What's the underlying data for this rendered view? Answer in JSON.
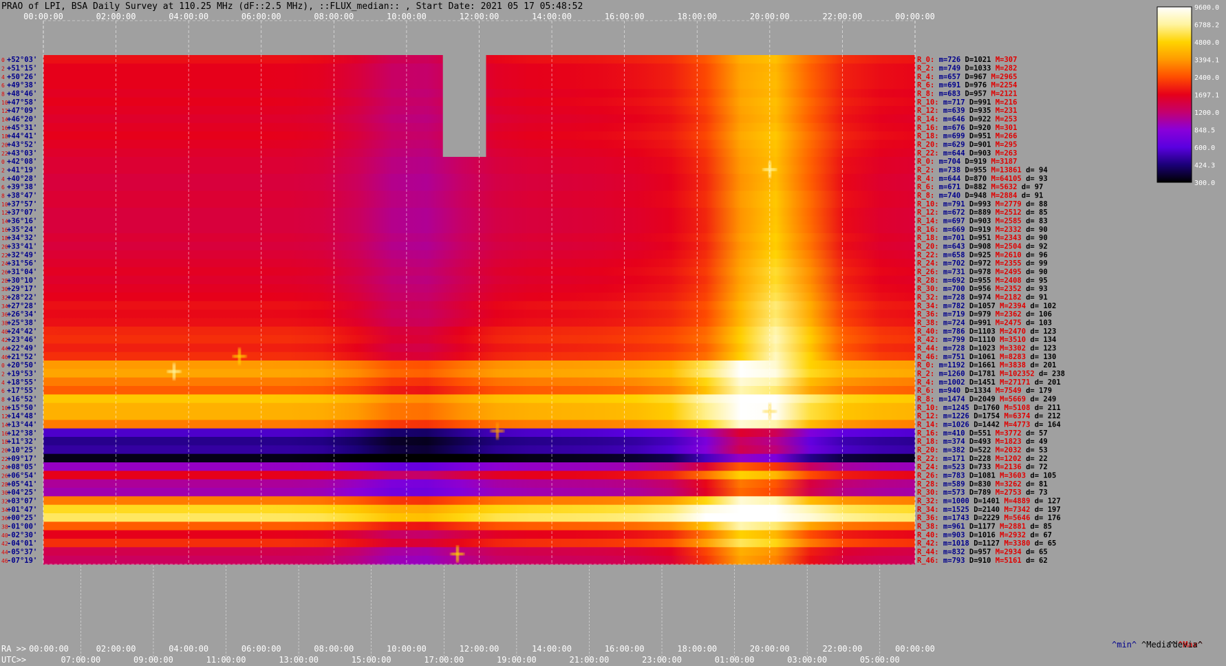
{
  "chart_data": {
    "type": "heatmap",
    "title": "PRAO of LPI, BSA Daily Survey at 110.25 MHz (dF::2.5 MHz), ::FLUX_median:: , Start Date: 2021 05 17 05:48:52",
    "ra_axis_label": "RA >>",
    "utc_axis_label": "UTC>>",
    "ra_ticks": [
      "00:00:00",
      "02:00:00",
      "04:00:00",
      "06:00:00",
      "08:00:00",
      "10:00:00",
      "12:00:00",
      "14:00:00",
      "16:00:00",
      "18:00:00",
      "20:00:00",
      "22:00:00",
      "00:00:00"
    ],
    "utc_ticks": [
      "07:00:00",
      "09:00:00",
      "11:00:00",
      "13:00:00",
      "15:00:00",
      "17:00:00",
      "19:00:00",
      "21:00:00",
      "23:00:00",
      "01:00:00",
      "03:00:00",
      "05:00:00"
    ],
    "color_scale_ticks": [
      "9600.0",
      "6788.2",
      "4800.0",
      "3394.1",
      "2400.0",
      "1697.1",
      "1200.0",
      "848.5",
      "600.0",
      "424.3",
      "300.0"
    ],
    "color_scale_colors": [
      "#ffffff",
      "#fff4a0",
      "#ffd300",
      "#ff9a00",
      "#ff4d00",
      "#e6001a",
      "#c4006e",
      "#8a00d9",
      "#5a00e0",
      "#1a0077",
      "#000000"
    ],
    "declinations": [
      "+52°03'",
      "+51°15'",
      "+50°26'",
      "+49°38'",
      "+48°46'",
      "+47°58'",
      "+47°09'",
      "+46°20'",
      "+45°31'",
      "+44°41'",
      "+43°52'",
      "+43°03'",
      "+42°08'",
      "+41°19'",
      "+40°28'",
      "+39°38'",
      "+38°47'",
      "+37°57'",
      "+37°07'",
      "+36°16'",
      "+35°24'",
      "+34°32'",
      "+33°41'",
      "+32°49'",
      "+31°56'",
      "+31°04'",
      "+30°10'",
      "+29°17'",
      "+28°22'",
      "+27°28'",
      "+26°34'",
      "+25°38'",
      "+24°42'",
      "+23°46'",
      "+22°49'",
      "+21°52'",
      "+20°50'",
      "+19°53'",
      "+18°55'",
      "+17°55'",
      "+16°52'",
      "+15°50'",
      "+14°48'",
      "+13°44'",
      "+12°38'",
      "+11°32'",
      "+10°25'",
      "+09°17'",
      "+08°05'",
      "+06°54'",
      "+05°41'",
      "+04°25'",
      "+03°07'",
      "+01°47'",
      "+00°25'",
      "-01°00'",
      "-02°30'",
      "-04°01'",
      "-05°37'",
      "-07°19'"
    ],
    "row_numbers": [
      "0",
      "2",
      "4",
      "6",
      "8",
      "10",
      "12",
      "14",
      "16",
      "18",
      "20",
      "22",
      "0",
      "2",
      "4",
      "6",
      "8",
      "10",
      "12",
      "14",
      "16",
      "18",
      "20",
      "22",
      "24",
      "26",
      "28",
      "30",
      "32",
      "34",
      "36",
      "38",
      "40",
      "42",
      "44",
      "46",
      "0",
      "2",
      "4",
      "6",
      "8",
      "10",
      "12",
      "14",
      "16",
      "18",
      "20",
      "22",
      "24",
      "26",
      "28",
      "30",
      "32",
      "34",
      "36",
      "38",
      "40",
      "42",
      "44",
      "46"
    ],
    "row_stats": [
      {
        "r": "R_0:",
        "m": "m=726",
        "d": "D=1021",
        "h": "M=307",
        "dv": ""
      },
      {
        "r": "R_2:",
        "m": "m=749",
        "d": "D=1033",
        "h": "M=282",
        "dv": ""
      },
      {
        "r": "R_4:",
        "m": "m=657",
        "d": "D=967",
        "h": "M=2965",
        "dv": ""
      },
      {
        "r": "R_6:",
        "m": "m=691",
        "d": "D=976",
        "h": "M=2254",
        "dv": ""
      },
      {
        "r": "R_8:",
        "m": "m=683",
        "d": "D=957",
        "h": "M=2121",
        "dv": ""
      },
      {
        "r": "R_10:",
        "m": "m=717",
        "d": "D=991",
        "h": "M=216",
        "dv": ""
      },
      {
        "r": "R_12:",
        "m": "m=639",
        "d": "D=935",
        "h": "M=231",
        "dv": ""
      },
      {
        "r": "R_14:",
        "m": "m=646",
        "d": "D=922",
        "h": "M=253",
        "dv": ""
      },
      {
        "r": "R_16:",
        "m": "m=676",
        "d": "D=920",
        "h": "M=301",
        "dv": ""
      },
      {
        "r": "R_18:",
        "m": "m=699",
        "d": "D=951",
        "h": "M=266",
        "dv": ""
      },
      {
        "r": "R_20:",
        "m": "m=629",
        "d": "D=901",
        "h": "M=295",
        "dv": ""
      },
      {
        "r": "R_22:",
        "m": "m=644",
        "d": "D=903",
        "h": "M=263",
        "dv": ""
      },
      {
        "r": "R_0:",
        "m": "m=704",
        "d": "D=919",
        "h": "M=3187",
        "dv": ""
      },
      {
        "r": "R_2:",
        "m": "m=738",
        "d": "D=955",
        "h": "M=13861",
        "dv": "d= 94"
      },
      {
        "r": "R_4:",
        "m": "m=644",
        "d": "D=870",
        "h": "M=64105",
        "dv": "d= 93"
      },
      {
        "r": "R_6:",
        "m": "m=671",
        "d": "D=882",
        "h": "M=5632",
        "dv": "d= 97"
      },
      {
        "r": "R_8:",
        "m": "m=740",
        "d": "D=948",
        "h": "M=2884",
        "dv": "d= 91"
      },
      {
        "r": "R_10:",
        "m": "m=791",
        "d": "D=993",
        "h": "M=2779",
        "dv": "d= 88"
      },
      {
        "r": "R_12:",
        "m": "m=672",
        "d": "D=889",
        "h": "M=2512",
        "dv": "d= 85"
      },
      {
        "r": "R_14:",
        "m": "m=697",
        "d": "D=903",
        "h": "M=2585",
        "dv": "d= 83"
      },
      {
        "r": "R_16:",
        "m": "m=669",
        "d": "D=919",
        "h": "M=2332",
        "dv": "d= 90"
      },
      {
        "r": "R_18:",
        "m": "m=701",
        "d": "D=951",
        "h": "M=2343",
        "dv": "d= 90"
      },
      {
        "r": "R_20:",
        "m": "m=643",
        "d": "D=908",
        "h": "M=2504",
        "dv": "d= 92"
      },
      {
        "r": "R_22:",
        "m": "m=658",
        "d": "D=925",
        "h": "M=2610",
        "dv": "d= 96"
      },
      {
        "r": "R_24:",
        "m": "m=702",
        "d": "D=972",
        "h": "M=2355",
        "dv": "d= 99"
      },
      {
        "r": "R_26:",
        "m": "m=731",
        "d": "D=978",
        "h": "M=2495",
        "dv": "d= 90"
      },
      {
        "r": "R_28:",
        "m": "m=692",
        "d": "D=955",
        "h": "M=2408",
        "dv": "d= 95"
      },
      {
        "r": "R_30:",
        "m": "m=700",
        "d": "D=956",
        "h": "M=2352",
        "dv": "d= 93"
      },
      {
        "r": "R_32:",
        "m": "m=728",
        "d": "D=974",
        "h": "M=2182",
        "dv": "d= 91"
      },
      {
        "r": "R_34:",
        "m": "m=782",
        "d": "D=1057",
        "h": "M=2394",
        "dv": "d= 102"
      },
      {
        "r": "R_36:",
        "m": "m=719",
        "d": "D=979",
        "h": "M=2362",
        "dv": "d= 106"
      },
      {
        "r": "R_38:",
        "m": "m=724",
        "d": "D=991",
        "h": "M=2475",
        "dv": "d= 103"
      },
      {
        "r": "R_40:",
        "m": "m=786",
        "d": "D=1103",
        "h": "M=2470",
        "dv": "d= 123"
      },
      {
        "r": "R_42:",
        "m": "m=799",
        "d": "D=1110",
        "h": "M=3510",
        "dv": "d= 134"
      },
      {
        "r": "R_44:",
        "m": "m=728",
        "d": "D=1023",
        "h": "M=3302",
        "dv": "d= 123"
      },
      {
        "r": "R_46:",
        "m": "m=751",
        "d": "D=1061",
        "h": "M=8283",
        "dv": "d= 130"
      },
      {
        "r": "R_0:",
        "m": "m=1192",
        "d": "D=1661",
        "h": "M=3838",
        "dv": "d= 201"
      },
      {
        "r": "R_2:",
        "m": "m=1260",
        "d": "D=1781",
        "h": "M=102352",
        "dv": "d= 238"
      },
      {
        "r": "R_4:",
        "m": "m=1002",
        "d": "D=1451",
        "h": "M=27171",
        "dv": "d= 201"
      },
      {
        "r": "R_6:",
        "m": "m=940",
        "d": "D=1334",
        "h": "M=7549",
        "dv": "d= 179"
      },
      {
        "r": "R_8:",
        "m": "m=1474",
        "d": "D=2049",
        "h": "M=5669",
        "dv": "d= 249"
      },
      {
        "r": "R_10:",
        "m": "m=1245",
        "d": "D=1760",
        "h": "M=5108",
        "dv": "d= 211"
      },
      {
        "r": "R_12:",
        "m": "m=1226",
        "d": "D=1754",
        "h": "M=6374",
        "dv": "d= 212"
      },
      {
        "r": "R_14:",
        "m": "m=1026",
        "d": "D=1442",
        "h": "M=4773",
        "dv": "d= 164"
      },
      {
        "r": "R_16:",
        "m": "m=410",
        "d": "D=551",
        "h": "M=3772",
        "dv": "d= 57"
      },
      {
        "r": "R_18:",
        "m": "m=374",
        "d": "D=493",
        "h": "M=1823",
        "dv": "d= 49"
      },
      {
        "r": "R_20:",
        "m": "m=382",
        "d": "D=522",
        "h": "M=2032",
        "dv": "d= 53"
      },
      {
        "r": "R_22:",
        "m": "m=171",
        "d": "D=228",
        "h": "M=1202",
        "dv": "d= 22"
      },
      {
        "r": "R_24:",
        "m": "m=523",
        "d": "D=733",
        "h": "M=2136",
        "dv": "d= 72"
      },
      {
        "r": "R_26:",
        "m": "m=783",
        "d": "D=1081",
        "h": "M=3603",
        "dv": "d= 105"
      },
      {
        "r": "R_28:",
        "m": "m=589",
        "d": "D=830",
        "h": "M=3262",
        "dv": "d= 81"
      },
      {
        "r": "R_30:",
        "m": "m=573",
        "d": "D=789",
        "h": "M=2753",
        "dv": "d= 73"
      },
      {
        "r": "R_32:",
        "m": "m=1000",
        "d": "D=1401",
        "h": "M=4889",
        "dv": "d= 127"
      },
      {
        "r": "R_34:",
        "m": "m=1525",
        "d": "D=2140",
        "h": "M=7342",
        "dv": "d= 197"
      },
      {
        "r": "R_36:",
        "m": "m=1743",
        "d": "D=2229",
        "h": "M=5646",
        "dv": "d= 176"
      },
      {
        "r": "R_38:",
        "m": "m=961",
        "d": "D=1177",
        "h": "M=2881",
        "dv": "d= 85"
      },
      {
        "r": "R_40:",
        "m": "m=903",
        "d": "D=1016",
        "h": "M=2932",
        "dv": "d= 67"
      },
      {
        "r": "R_42:",
        "m": "m=1018",
        "d": "D=1127",
        "h": "M=3380",
        "dv": "d= 65"
      },
      {
        "r": "R_44:",
        "m": "m=832",
        "d": "D=957",
        "h": "M=2934",
        "dv": "d= 65"
      },
      {
        "r": "R_46:",
        "m": "m=793",
        "d": "D=910",
        "h": "M=5161",
        "dv": "d= 62"
      }
    ],
    "stat_legend": {
      "min": "^min^",
      "median": "^Media^",
      "max": "^Max^",
      "devia": "^devia^"
    },
    "row_base_level": [
      0.52,
      0.5,
      0.5,
      0.5,
      0.49,
      0.5,
      0.49,
      0.48,
      0.49,
      0.5,
      0.49,
      0.48,
      0.47,
      0.47,
      0.46,
      0.46,
      0.47,
      0.47,
      0.46,
      0.46,
      0.46,
      0.47,
      0.46,
      0.47,
      0.48,
      0.49,
      0.48,
      0.49,
      0.5,
      0.52,
      0.51,
      0.52,
      0.55,
      0.56,
      0.54,
      0.56,
      0.7,
      0.72,
      0.66,
      0.62,
      0.78,
      0.74,
      0.74,
      0.66,
      0.18,
      0.12,
      0.14,
      0.02,
      0.32,
      0.5,
      0.36,
      0.34,
      0.66,
      0.82,
      0.86,
      0.62,
      0.5,
      0.56,
      0.44,
      0.42
    ],
    "data_gap": {
      "ra_start": "11:00:00",
      "ra_end": "12:00:00",
      "rows": "0-11"
    }
  }
}
